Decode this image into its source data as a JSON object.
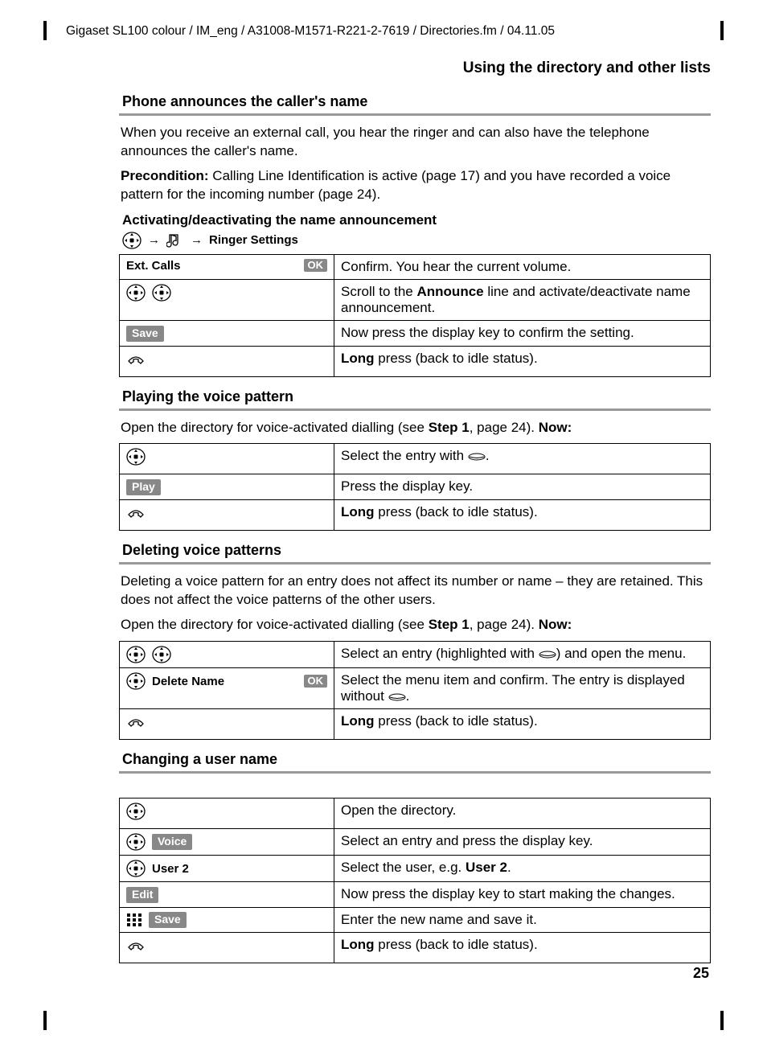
{
  "header": "Gigaset SL100 colour / IM_eng / A31008-M1571-R221-2-7619 / Directories.fm / 04.11.05",
  "section_title": "Using the directory and other lists",
  "s1": {
    "h": "Phone announces the caller's name",
    "p1a": "When you receive an external call, you hear the ringer and can also have the telephone announces the caller's name.",
    "p1b_label": "Precondition:",
    "p1b": " Calling Line Identification is active (page 17) and you have recorded a voice pattern for the incoming number (page 24).",
    "h4": "Activating/deactivating the name announcement",
    "path_text": "Ringer Settings",
    "rows": [
      {
        "l_text": "Ext. Calls",
        "l_ok": "OK",
        "r": "Confirm. You hear the current volume."
      },
      {
        "r_pre": "Scroll to the ",
        "r_b": "Announce",
        "r_post": " line and activate/deactivate name announcement."
      },
      {
        "l_key": "Save",
        "r": "Now press the display key to confirm the setting."
      },
      {
        "r_b": "Long",
        "r_post": " press (back to idle status)."
      }
    ]
  },
  "s2": {
    "h": "Playing the voice pattern",
    "p_pre": "Open the directory for voice-activated dialling (see ",
    "p_b1": "Step 1",
    "p_mid": ", page 24). ",
    "p_b2": "Now:",
    "rows": [
      {
        "r_pre": "Select the entry with ",
        "r_post": "."
      },
      {
        "l_key": "Play",
        "r": "Press the display key."
      },
      {
        "r_b": "Long",
        "r_post": " press (back to idle status)."
      }
    ]
  },
  "s3": {
    "h": "Deleting voice patterns",
    "p1": "Deleting a voice pattern for an entry does not affect its number or name – they are retained. This does not affect the voice patterns of the other users.",
    "p2_pre": "Open the directory for voice-activated dialling (see ",
    "p2_b1": "Step 1",
    "p2_mid": ", page 24). ",
    "p2_b2": "Now:",
    "rows": [
      {
        "r_pre": "Select an entry (highlighted with ",
        "r_post": ") and open the menu."
      },
      {
        "l_text": "Delete Name",
        "l_ok": "OK",
        "r_pre": "Select the menu item and confirm. The entry is displayed without ",
        "r_post": "."
      },
      {
        "r_b": "Long",
        "r_post": " press (back to idle status)."
      }
    ]
  },
  "s4": {
    "h": "Changing a user name",
    "rows": [
      {
        "r": "Open the directory."
      },
      {
        "l_key": "Voice",
        "r": "Select an entry and press the display key."
      },
      {
        "l_text": "User 2",
        "r_pre": "Select the user, e.g. ",
        "r_b": "User 2",
        "r_post": "."
      },
      {
        "l_key": "Edit",
        "r": "Now press the display key to start making the changes."
      },
      {
        "l_key": "Save",
        "r": "Enter the new name and save it."
      },
      {
        "r_b": "Long",
        "r_post": " press (back to idle status)."
      }
    ]
  },
  "page_number": "25"
}
